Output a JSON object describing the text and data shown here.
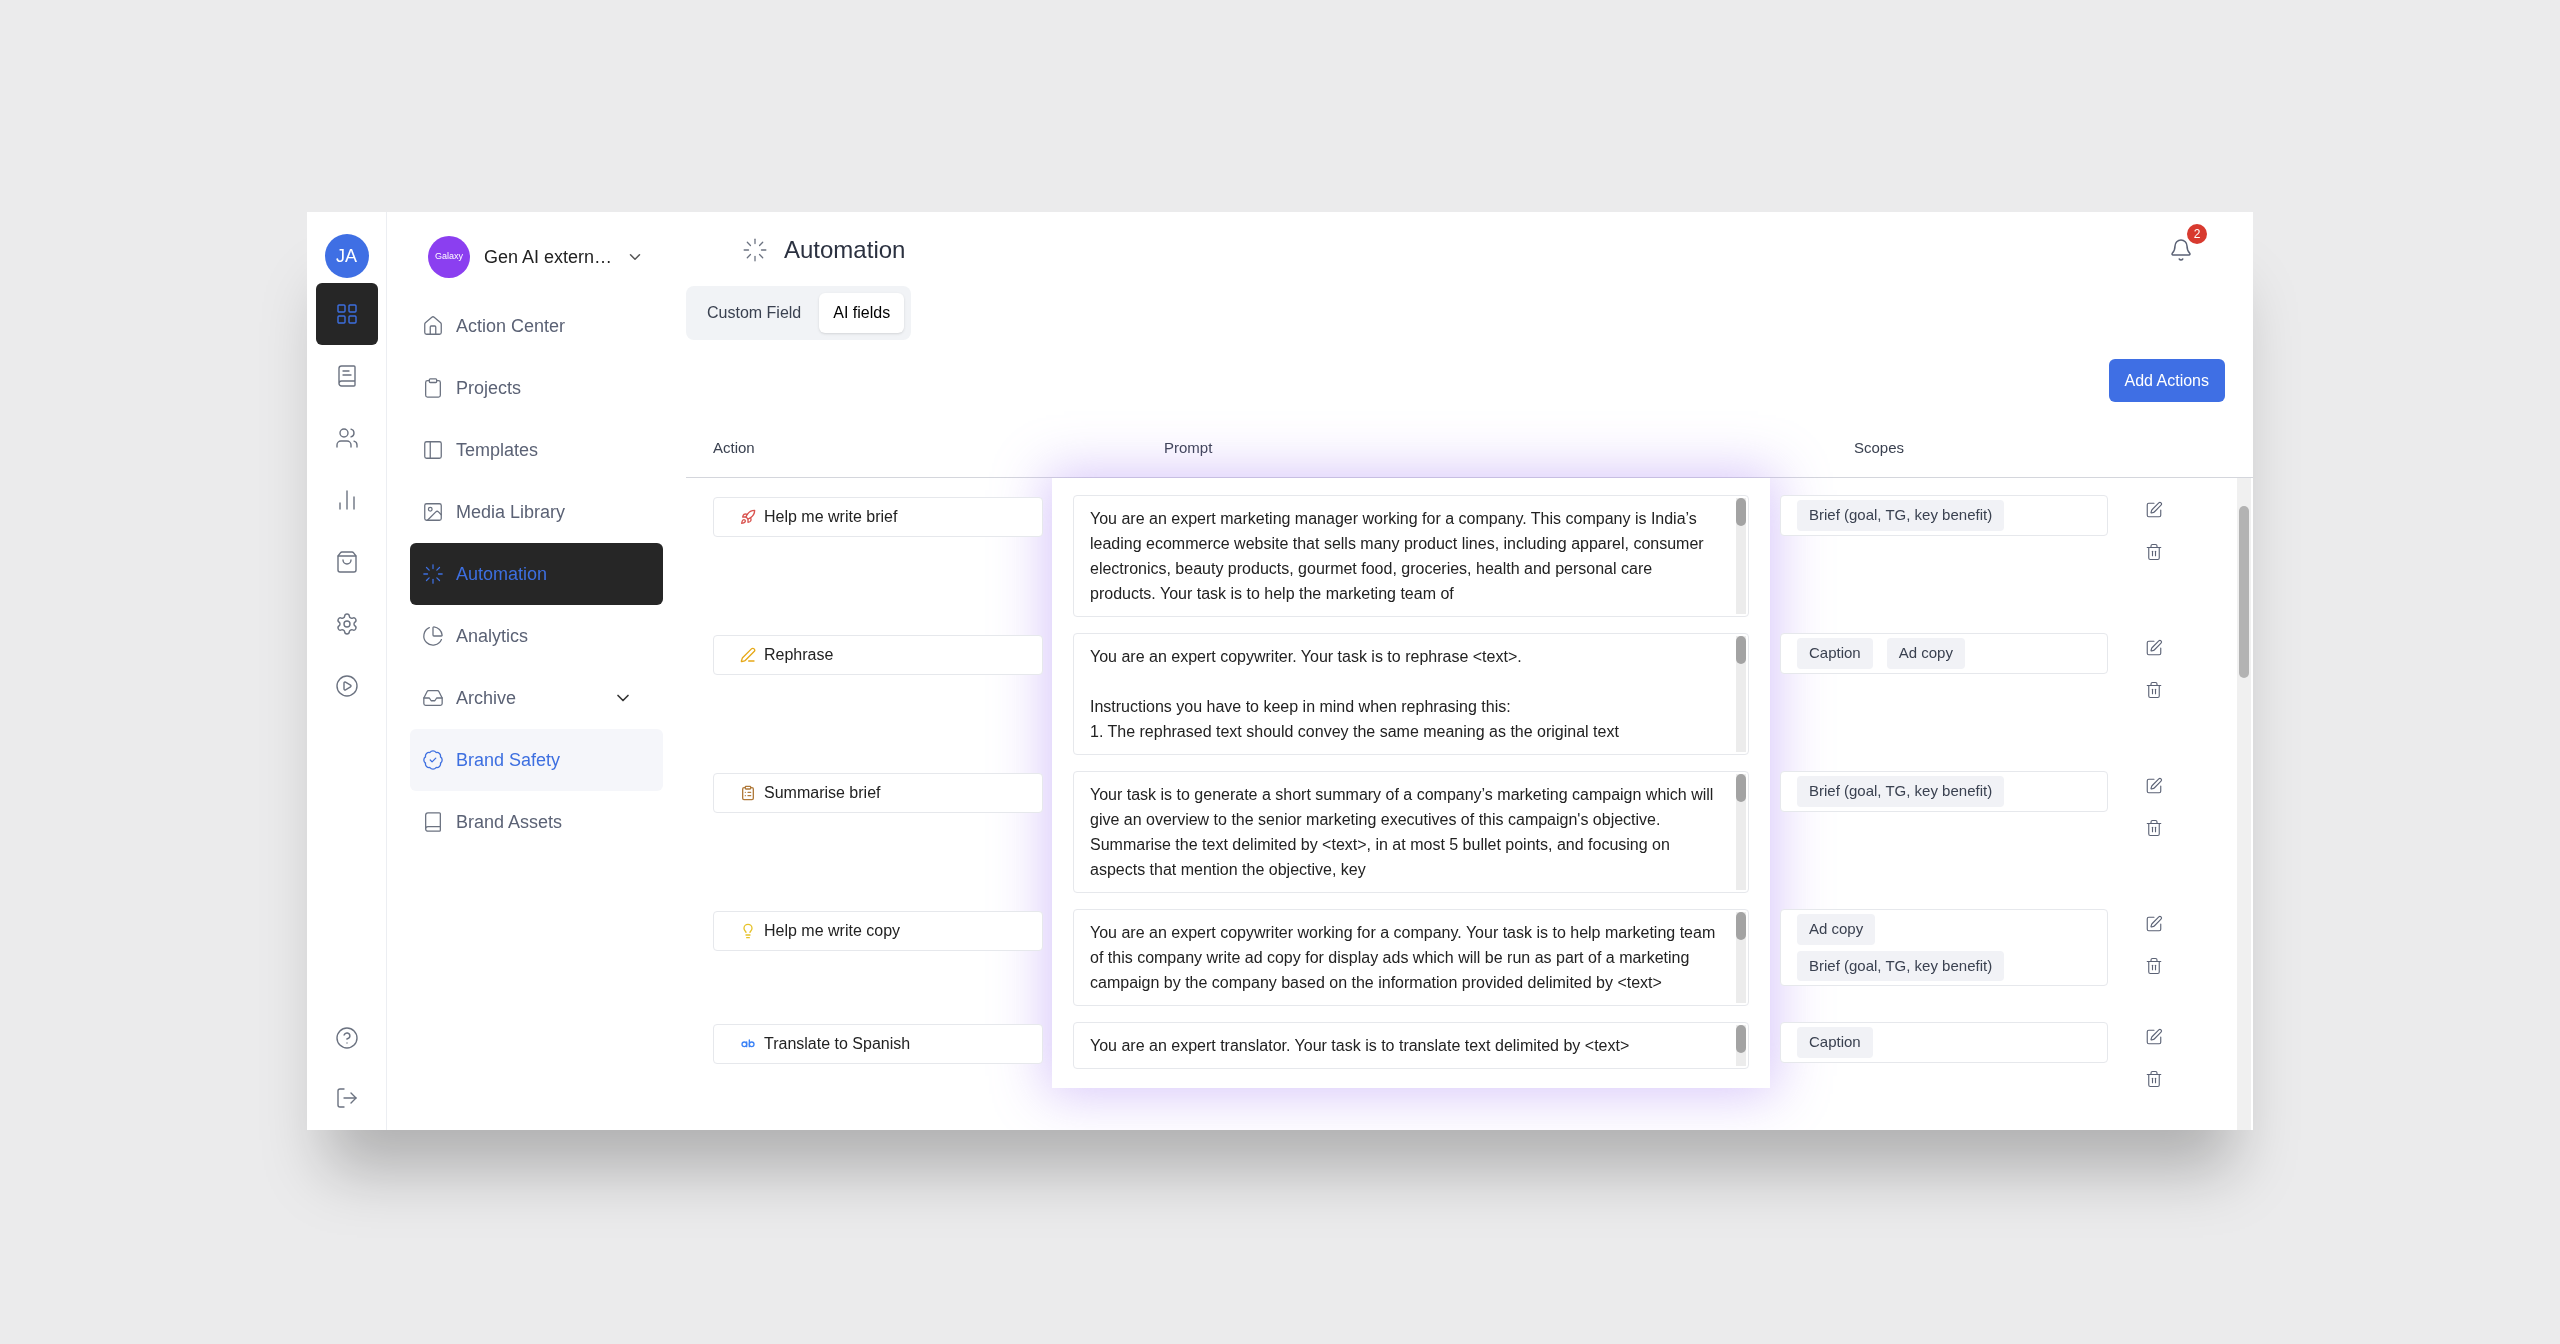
{
  "rail": {
    "avatar": "JA",
    "items": [
      {
        "selected": true
      },
      {
        "selected": false
      },
      {
        "selected": false
      },
      {
        "selected": false
      },
      {
        "selected": false
      },
      {
        "selected": false
      },
      {
        "selected": false
      }
    ]
  },
  "org": {
    "logo": "Galaxy",
    "name": "Gen AI extern…"
  },
  "nav": [
    {
      "label": "Action Center",
      "selected": false
    },
    {
      "label": "Projects",
      "selected": false
    },
    {
      "label": "Templates",
      "selected": false
    },
    {
      "label": "Media Library",
      "selected": false
    },
    {
      "label": "Automation",
      "selected": true
    },
    {
      "label": "Analytics",
      "selected": false
    },
    {
      "label": "Archive",
      "selected": false,
      "expanded": true,
      "children": [
        {
          "label": "Brand Safety",
          "selected": true
        },
        {
          "label": "Brand Assets",
          "selected": false
        }
      ]
    }
  ],
  "header": {
    "title": "Automation",
    "notifications": "2"
  },
  "tabs": [
    {
      "label": "Custom Field",
      "selected": false
    },
    {
      "label": "AI fields",
      "selected": true
    }
  ],
  "add_button": "Add Actions",
  "table": {
    "columns": [
      "Action",
      "Prompt",
      "Scopes"
    ],
    "rows": [
      {
        "action": "Help me write brief",
        "prompt": "You are an expert marketing manager working for a company. This company is India’s leading ecommerce website that sells many product lines, including apparel, consumer electronics, beauty products, gourmet food, groceries, health and personal care products. Your task is to help the marketing team of",
        "scopes": [
          "Brief (goal, TG, key benefit)"
        ]
      },
      {
        "action": "Rephrase",
        "prompt": "You are an expert copywriter. Your task is to rephrase <text>.\n\nInstructions you have to keep in mind when rephrasing this:\n1. The rephrased text should convey the same meaning as the original text",
        "scopes": [
          "Caption",
          "Ad copy"
        ]
      },
      {
        "action": "Summarise brief",
        "prompt": "Your task is to generate a short summary of a company’s marketing campaign which will give an overview to the senior marketing executives of this campaign's objective. Summarise the text delimited by <text>, in at most 5 bullet points, and focusing on aspects that mention the objective, key",
        "scopes": [
          "Brief (goal, TG, key benefit)"
        ]
      },
      {
        "action": "Help me write copy",
        "prompt": "You are an expert copywriter working for a company. Your task is to help marketing team of this company write ad copy for display ads which will be run as part of a marketing campaign by the company based on the information provided delimited by <text>",
        "scopes": [
          "Ad copy",
          "Brief (goal, TG, key benefit)"
        ]
      },
      {
        "action": "Translate to Spanish",
        "prompt": "You are an expert translator. Your task is to translate text delimited by <text>",
        "scopes": [
          "Caption"
        ]
      }
    ]
  }
}
